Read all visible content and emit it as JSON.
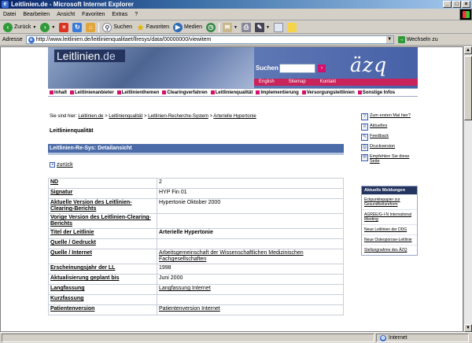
{
  "window": {
    "title": "Leitlinien.de - Microsoft Internet Explorer",
    "controls": [
      "_",
      "□",
      "×"
    ]
  },
  "menu": [
    "Datei",
    "Bearbeiten",
    "Ansicht",
    "Favoriten",
    "Extras",
    "?"
  ],
  "toolbar": {
    "back": "Zurück",
    "search": "Suchen",
    "favorites": "Favoriten",
    "media": "Medien"
  },
  "address": {
    "label": "Adresse",
    "url": "http://www.leitlinien.de/leitlinienqualitaet/llresys/data/00000000/viewitem",
    "go": "Wechseln zu"
  },
  "banner": {
    "logo_text_a": "Leitlinien",
    "logo_text_b": ".de",
    "search_label": "Suchen",
    "search_go": "›",
    "brand": "äzq",
    "links": [
      "English",
      "Sitemap",
      "Kontakt"
    ]
  },
  "nav": [
    "Inhalt",
    "Leitlinienanbieter",
    "Leitlinienthemen",
    "Clearingverfahren",
    "Leitlinienqualität",
    "Implementierung",
    "Versorgungsleitlinien",
    "Sonstige Infos"
  ],
  "breadcrumb": {
    "prefix": "Sie sind hier:",
    "items": [
      "Leitlinien.de",
      "Leitlinienqualität",
      "Leitlinien-Recherche-System",
      "Arterielle Hypertonie"
    ],
    "sep": ">"
  },
  "page_title": "Leitlinienqualität",
  "section_title": "Leitlinien-Re-Sys: Detailansicht",
  "back_label": "zurück",
  "table": [
    {
      "key": "ND",
      "value": "2"
    },
    {
      "key": "Signatur",
      "value": "HYP Fin 01"
    },
    {
      "key": "Aktuelle Version des Leitlinien-Clearing-Berichts",
      "value": "Hypertonie Oktober 2000"
    },
    {
      "key": "Vorige Version des Leitlinien-Clearing-Berichts",
      "value": ""
    },
    {
      "key": "Titel der Leitlinie",
      "value": "Arterielle Hypertonie"
    },
    {
      "key": "Quelle / Gedruckt",
      "value": ""
    },
    {
      "key": "Quelle / Internet",
      "value": "Arbeitsgemeinschaft der Wissenschaftlichen Medizinischen Fachgesellschaften"
    },
    {
      "key": "Erscheinungsjahr der LL",
      "value": "1998"
    },
    {
      "key": "Aktualisierung geplant bis",
      "value": "Juni 2000"
    },
    {
      "key": "Langfassung",
      "value": "Langfassung Internet"
    },
    {
      "key": "Kurzfassung",
      "value": ""
    },
    {
      "key": "Patientenversion",
      "value": "Patientenversion Internet"
    }
  ],
  "sidebar_links": [
    "Zum ersten Mal hier?",
    "Aktuelles",
    "Feedback",
    "Druckversion",
    "Empfehlen Sie diese Seite"
  ],
  "news": {
    "heading": "Aktuelle Meldungen",
    "items": [
      "Eckpunktepapier zur Gesundheitsreform",
      "AGREE/G-I-N International Meeting",
      "Neue Leitlinien der DDG",
      "Neue Osteoporose-Leitlinie",
      "Stellungnahme des ÄZQ"
    ]
  },
  "status": {
    "zone": "Internet"
  }
}
